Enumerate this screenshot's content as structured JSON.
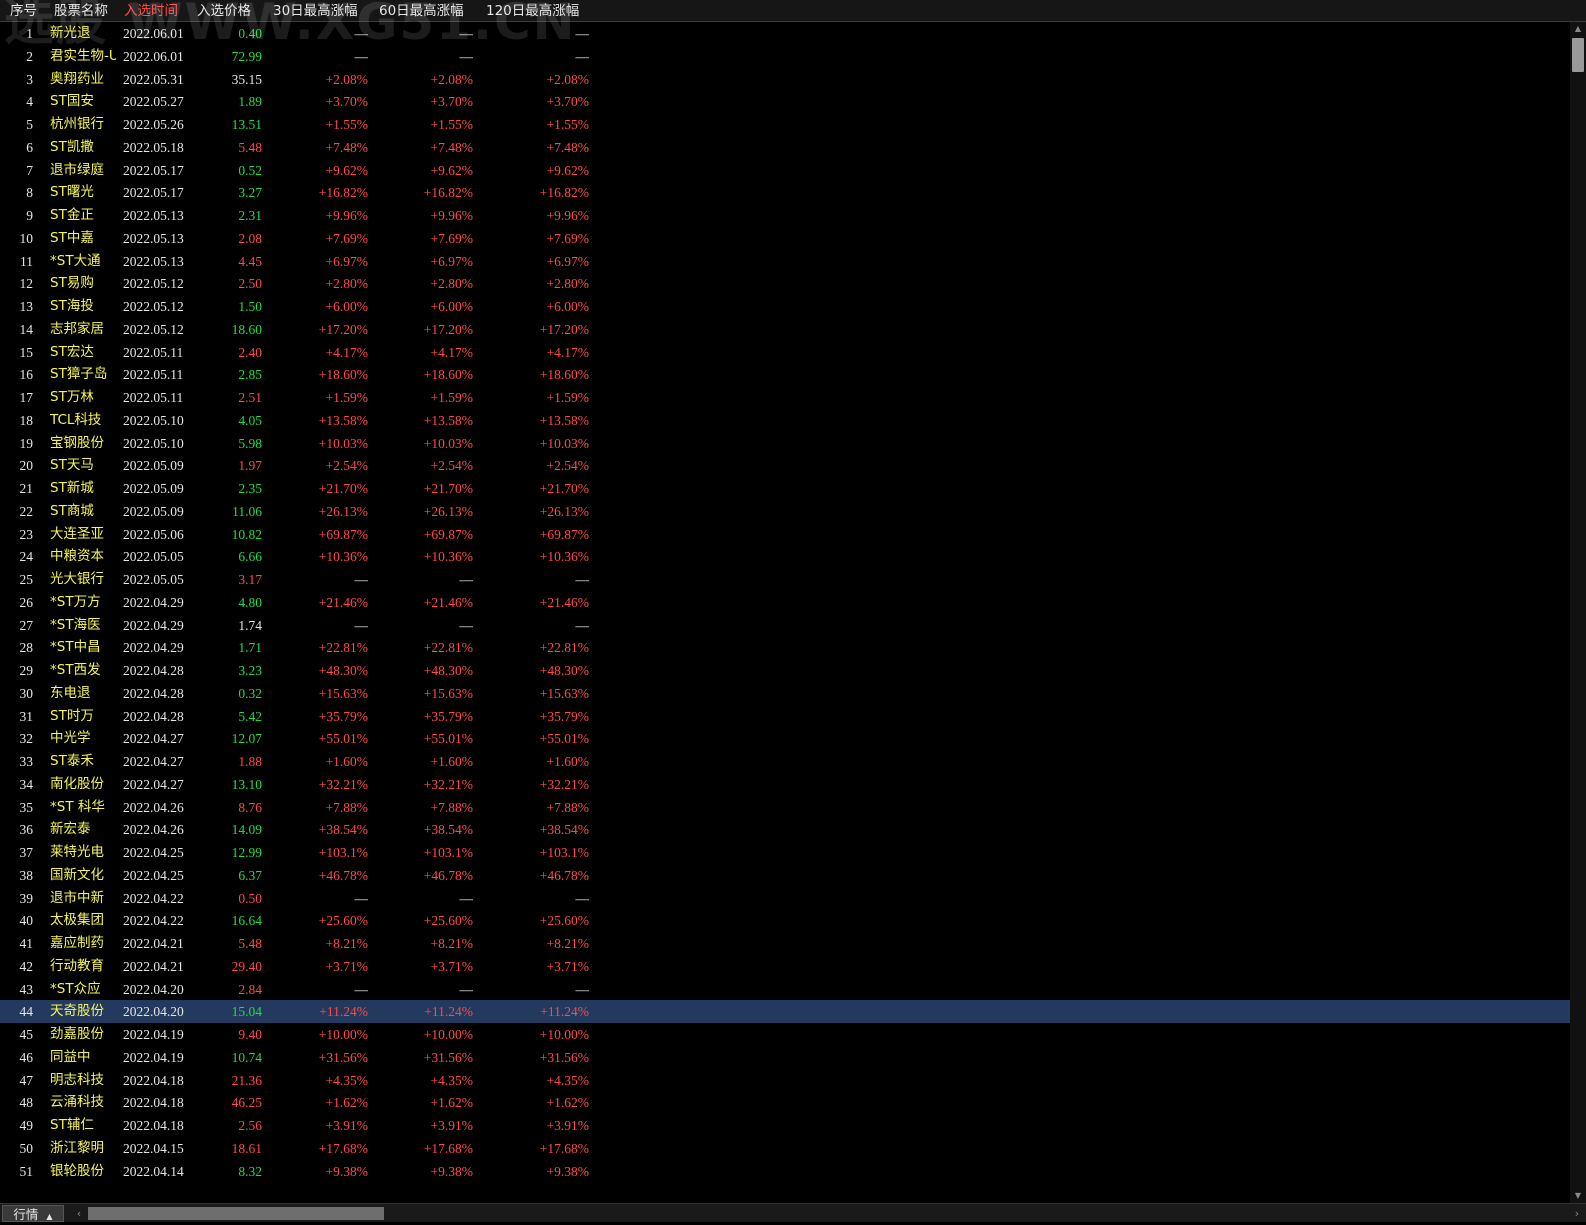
{
  "watermark": "选股 WWW.XG51.CN",
  "columns": {
    "idx": "序号",
    "name": "股票名称",
    "date": "入选时间",
    "price": "入选价格",
    "p30": "30日最高涨幅",
    "p60": "60日最高涨幅",
    "p120": "120日最高涨幅"
  },
  "active_column": "date",
  "colors": {
    "up": "#ff4a4a",
    "down": "#22dd44",
    "name": "#f5f55a",
    "selected_row": "#23395d"
  },
  "rows": [
    {
      "idx": "1",
      "name": "新光退",
      "date": "2022.06.01",
      "price": "0.40",
      "pc": "down",
      "p30": "—",
      "p60": "—",
      "p120": "—"
    },
    {
      "idx": "2",
      "name": "君实生物-U",
      "date": "2022.06.01",
      "price": "72.99",
      "pc": "down",
      "p30": "—",
      "p60": "—",
      "p120": "—"
    },
    {
      "idx": "3",
      "name": "奥翔药业",
      "date": "2022.05.31",
      "price": "35.15",
      "pc": "flat",
      "p30": "+2.08%",
      "p60": "+2.08%",
      "p120": "+2.08%"
    },
    {
      "idx": "4",
      "name": "ST国安",
      "date": "2022.05.27",
      "price": "1.89",
      "pc": "down",
      "p30": "+3.70%",
      "p60": "+3.70%",
      "p120": "+3.70%"
    },
    {
      "idx": "5",
      "name": "杭州银行",
      "date": "2022.05.26",
      "price": "13.51",
      "pc": "down",
      "p30": "+1.55%",
      "p60": "+1.55%",
      "p120": "+1.55%"
    },
    {
      "idx": "6",
      "name": "ST凯撒",
      "date": "2022.05.18",
      "price": "5.48",
      "pc": "up",
      "p30": "+7.48%",
      "p60": "+7.48%",
      "p120": "+7.48%"
    },
    {
      "idx": "7",
      "name": "退市绿庭",
      "date": "2022.05.17",
      "price": "0.52",
      "pc": "down",
      "p30": "+9.62%",
      "p60": "+9.62%",
      "p120": "+9.62%"
    },
    {
      "idx": "8",
      "name": "ST曙光",
      "date": "2022.05.17",
      "price": "3.27",
      "pc": "down",
      "p30": "+16.82%",
      "p60": "+16.82%",
      "p120": "+16.82%"
    },
    {
      "idx": "9",
      "name": "ST金正",
      "date": "2022.05.13",
      "price": "2.31",
      "pc": "down",
      "p30": "+9.96%",
      "p60": "+9.96%",
      "p120": "+9.96%"
    },
    {
      "idx": "10",
      "name": "ST中嘉",
      "date": "2022.05.13",
      "price": "2.08",
      "pc": "up",
      "p30": "+7.69%",
      "p60": "+7.69%",
      "p120": "+7.69%"
    },
    {
      "idx": "11",
      "name": "*ST大通",
      "date": "2022.05.13",
      "price": "4.45",
      "pc": "up",
      "p30": "+6.97%",
      "p60": "+6.97%",
      "p120": "+6.97%"
    },
    {
      "idx": "12",
      "name": "ST易购",
      "date": "2022.05.12",
      "price": "2.50",
      "pc": "up",
      "p30": "+2.80%",
      "p60": "+2.80%",
      "p120": "+2.80%"
    },
    {
      "idx": "13",
      "name": "ST海投",
      "date": "2022.05.12",
      "price": "1.50",
      "pc": "down",
      "p30": "+6.00%",
      "p60": "+6.00%",
      "p120": "+6.00%"
    },
    {
      "idx": "14",
      "name": "志邦家居",
      "date": "2022.05.12",
      "price": "18.60",
      "pc": "down",
      "p30": "+17.20%",
      "p60": "+17.20%",
      "p120": "+17.20%"
    },
    {
      "idx": "15",
      "name": "ST宏达",
      "date": "2022.05.11",
      "price": "2.40",
      "pc": "up",
      "p30": "+4.17%",
      "p60": "+4.17%",
      "p120": "+4.17%"
    },
    {
      "idx": "16",
      "name": "ST獐子岛",
      "date": "2022.05.11",
      "price": "2.85",
      "pc": "down",
      "p30": "+18.60%",
      "p60": "+18.60%",
      "p120": "+18.60%"
    },
    {
      "idx": "17",
      "name": "ST万林",
      "date": "2022.05.11",
      "price": "2.51",
      "pc": "up",
      "p30": "+1.59%",
      "p60": "+1.59%",
      "p120": "+1.59%"
    },
    {
      "idx": "18",
      "name": "TCL科技",
      "date": "2022.05.10",
      "price": "4.05",
      "pc": "down",
      "p30": "+13.58%",
      "p60": "+13.58%",
      "p120": "+13.58%"
    },
    {
      "idx": "19",
      "name": "宝钢股份",
      "date": "2022.05.10",
      "price": "5.98",
      "pc": "down",
      "p30": "+10.03%",
      "p60": "+10.03%",
      "p120": "+10.03%"
    },
    {
      "idx": "20",
      "name": "ST天马",
      "date": "2022.05.09",
      "price": "1.97",
      "pc": "up",
      "p30": "+2.54%",
      "p60": "+2.54%",
      "p120": "+2.54%"
    },
    {
      "idx": "21",
      "name": "ST新城",
      "date": "2022.05.09",
      "price": "2.35",
      "pc": "down",
      "p30": "+21.70%",
      "p60": "+21.70%",
      "p120": "+21.70%"
    },
    {
      "idx": "22",
      "name": "ST商城",
      "date": "2022.05.09",
      "price": "11.06",
      "pc": "down",
      "p30": "+26.13%",
      "p60": "+26.13%",
      "p120": "+26.13%"
    },
    {
      "idx": "23",
      "name": "大连圣亚",
      "date": "2022.05.06",
      "price": "10.82",
      "pc": "down",
      "p30": "+69.87%",
      "p60": "+69.87%",
      "p120": "+69.87%"
    },
    {
      "idx": "24",
      "name": "中粮资本",
      "date": "2022.05.05",
      "price": "6.66",
      "pc": "down",
      "p30": "+10.36%",
      "p60": "+10.36%",
      "p120": "+10.36%"
    },
    {
      "idx": "25",
      "name": "光大银行",
      "date": "2022.05.05",
      "price": "3.17",
      "pc": "up",
      "p30": "—",
      "p60": "—",
      "p120": "—"
    },
    {
      "idx": "26",
      "name": "*ST万方",
      "date": "2022.04.29",
      "price": "4.80",
      "pc": "down",
      "p30": "+21.46%",
      "p60": "+21.46%",
      "p120": "+21.46%"
    },
    {
      "idx": "27",
      "name": "*ST海医",
      "date": "2022.04.29",
      "price": "1.74",
      "pc": "flat",
      "p30": "—",
      "p60": "—",
      "p120": "—"
    },
    {
      "idx": "28",
      "name": "*ST中昌",
      "date": "2022.04.29",
      "price": "1.71",
      "pc": "down",
      "p30": "+22.81%",
      "p60": "+22.81%",
      "p120": "+22.81%"
    },
    {
      "idx": "29",
      "name": "*ST西发",
      "date": "2022.04.28",
      "price": "3.23",
      "pc": "down",
      "p30": "+48.30%",
      "p60": "+48.30%",
      "p120": "+48.30%"
    },
    {
      "idx": "30",
      "name": "东电退",
      "date": "2022.04.28",
      "price": "0.32",
      "pc": "down",
      "p30": "+15.63%",
      "p60": "+15.63%",
      "p120": "+15.63%"
    },
    {
      "idx": "31",
      "name": "ST时万",
      "date": "2022.04.28",
      "price": "5.42",
      "pc": "down",
      "p30": "+35.79%",
      "p60": "+35.79%",
      "p120": "+35.79%"
    },
    {
      "idx": "32",
      "name": "中光学",
      "date": "2022.04.27",
      "price": "12.07",
      "pc": "down",
      "p30": "+55.01%",
      "p60": "+55.01%",
      "p120": "+55.01%"
    },
    {
      "idx": "33",
      "name": "ST泰禾",
      "date": "2022.04.27",
      "price": "1.88",
      "pc": "up",
      "p30": "+1.60%",
      "p60": "+1.60%",
      "p120": "+1.60%"
    },
    {
      "idx": "34",
      "name": "南化股份",
      "date": "2022.04.27",
      "price": "13.10",
      "pc": "down",
      "p30": "+32.21%",
      "p60": "+32.21%",
      "p120": "+32.21%"
    },
    {
      "idx": "35",
      "name": "*ST 科华",
      "date": "2022.04.26",
      "price": "8.76",
      "pc": "up",
      "p30": "+7.88%",
      "p60": "+7.88%",
      "p120": "+7.88%"
    },
    {
      "idx": "36",
      "name": "新宏泰",
      "date": "2022.04.26",
      "price": "14.09",
      "pc": "down",
      "p30": "+38.54%",
      "p60": "+38.54%",
      "p120": "+38.54%"
    },
    {
      "idx": "37",
      "name": "莱特光电",
      "date": "2022.04.25",
      "price": "12.99",
      "pc": "down",
      "p30": "+103.1%",
      "p60": "+103.1%",
      "p120": "+103.1%"
    },
    {
      "idx": "38",
      "name": "国新文化",
      "date": "2022.04.25",
      "price": "6.37",
      "pc": "down",
      "p30": "+46.78%",
      "p60": "+46.78%",
      "p120": "+46.78%"
    },
    {
      "idx": "39",
      "name": "退市中新",
      "date": "2022.04.22",
      "price": "0.50",
      "pc": "up",
      "p30": "—",
      "p60": "—",
      "p120": "—"
    },
    {
      "idx": "40",
      "name": "太极集团",
      "date": "2022.04.22",
      "price": "16.64",
      "pc": "down",
      "p30": "+25.60%",
      "p60": "+25.60%",
      "p120": "+25.60%"
    },
    {
      "idx": "41",
      "name": "嘉应制药",
      "date": "2022.04.21",
      "price": "5.48",
      "pc": "up",
      "p30": "+8.21%",
      "p60": "+8.21%",
      "p120": "+8.21%"
    },
    {
      "idx": "42",
      "name": "行动教育",
      "date": "2022.04.21",
      "price": "29.40",
      "pc": "up",
      "p30": "+3.71%",
      "p60": "+3.71%",
      "p120": "+3.71%"
    },
    {
      "idx": "43",
      "name": "*ST众应",
      "date": "2022.04.20",
      "price": "2.84",
      "pc": "up",
      "p30": "—",
      "p60": "—",
      "p120": "—"
    },
    {
      "idx": "44",
      "name": "天奇股份",
      "date": "2022.04.20",
      "price": "15.04",
      "pc": "down",
      "p30": "+11.24%",
      "p60": "+11.24%",
      "p120": "+11.24%",
      "selected": true
    },
    {
      "idx": "45",
      "name": "劲嘉股份",
      "date": "2022.04.19",
      "price": "9.40",
      "pc": "up",
      "p30": "+10.00%",
      "p60": "+10.00%",
      "p120": "+10.00%"
    },
    {
      "idx": "46",
      "name": "同益中",
      "date": "2022.04.19",
      "price": "10.74",
      "pc": "down",
      "p30": "+31.56%",
      "p60": "+31.56%",
      "p120": "+31.56%"
    },
    {
      "idx": "47",
      "name": "明志科技",
      "date": "2022.04.18",
      "price": "21.36",
      "pc": "up",
      "p30": "+4.35%",
      "p60": "+4.35%",
      "p120": "+4.35%"
    },
    {
      "idx": "48",
      "name": "云涌科技",
      "date": "2022.04.18",
      "price": "46.25",
      "pc": "up",
      "p30": "+1.62%",
      "p60": "+1.62%",
      "p120": "+1.62%"
    },
    {
      "idx": "49",
      "name": "ST辅仁",
      "date": "2022.04.18",
      "price": "2.56",
      "pc": "up",
      "p30": "+3.91%",
      "p60": "+3.91%",
      "p120": "+3.91%"
    },
    {
      "idx": "50",
      "name": "浙江黎明",
      "date": "2022.04.15",
      "price": "18.61",
      "pc": "up",
      "p30": "+17.68%",
      "p60": "+17.68%",
      "p120": "+17.68%"
    },
    {
      "idx": "51",
      "name": "银轮股份",
      "date": "2022.04.14",
      "price": "8.32",
      "pc": "down",
      "p30": "+9.38%",
      "p60": "+9.38%",
      "p120": "+9.38%"
    }
  ],
  "bottom": {
    "tab_label": "行情",
    "tab_icon": "caret-up-icon",
    "scroll_left_icon": "chevron-left-icon",
    "scroll_right_icon": "chevron-right-icon",
    "scroll_up_icon": "triangle-up-icon",
    "scroll_down_icon": "triangle-down-icon"
  }
}
